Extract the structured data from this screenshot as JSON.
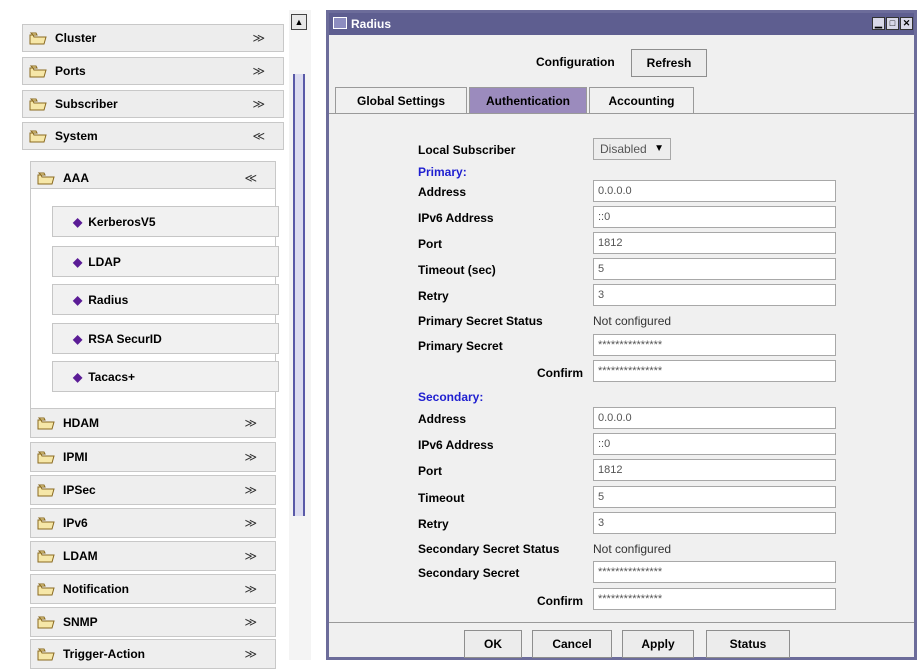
{
  "nav": {
    "top_items": [
      {
        "label": "Cluster",
        "chevron": "≫"
      },
      {
        "label": "Ports",
        "chevron": "≫"
      },
      {
        "label": "Subscriber",
        "chevron": "≫"
      },
      {
        "label": "System",
        "chevron": "≪"
      }
    ],
    "aaa": {
      "label": "AAA",
      "chevron": "≪"
    },
    "aaa_items": [
      "KerberosV5",
      "LDAP",
      "Radius",
      "RSA SecurID",
      "Tacacs+"
    ],
    "system_items": [
      {
        "label": "HDAM",
        "chevron": "≫"
      },
      {
        "label": "IPMI",
        "chevron": "≫"
      },
      {
        "label": "IPSec",
        "chevron": "≫"
      },
      {
        "label": "IPv6",
        "chevron": "≫"
      },
      {
        "label": "LDAM",
        "chevron": "≫"
      },
      {
        "label": "Notification",
        "chevron": "≫"
      },
      {
        "label": "SNMP",
        "chevron": "≫"
      },
      {
        "label": "Trigger-Action",
        "chevron": "≫"
      }
    ],
    "leaf_icon": "◆",
    "folder_icon": "folder-icon"
  },
  "window": {
    "title": "Radius",
    "configuration_label": "Configuration",
    "refresh_label": "Refresh",
    "tabs": [
      "Global Settings",
      "Authentication",
      "Accounting"
    ],
    "active_tab": "Authentication",
    "title_bar_color": "#5e5e90",
    "active_tab_color": "#9b8bbd"
  },
  "form": {
    "local_subscriber_label": "Local Subscriber",
    "local_subscriber_value": "Disabled",
    "primary": {
      "heading": "Primary:",
      "address_label": "Address",
      "address_value": "0.0.0.0",
      "ipv6_label": "IPv6 Address",
      "ipv6_value": "::0",
      "port_label": "Port",
      "port_value": "1812",
      "timeout_label": "Timeout (sec)",
      "timeout_value": "5",
      "retry_label": "Retry",
      "retry_value": "3",
      "secret_status_label": "Primary Secret Status",
      "secret_status_value": "Not configured",
      "secret_label": "Primary Secret",
      "secret_value": "***************",
      "confirm_label": "Confirm",
      "confirm_value": "***************"
    },
    "secondary": {
      "heading": "Secondary:",
      "address_label": "Address",
      "address_value": "0.0.0.0",
      "ipv6_label": "IPv6 Address",
      "ipv6_value": "::0",
      "port_label": "Port",
      "port_value": "1812",
      "timeout_label": "Timeout",
      "timeout_value": "5",
      "retry_label": "Retry",
      "retry_value": "3",
      "secret_status_label": "Secondary Secret Status",
      "secret_status_value": "Not configured",
      "secret_label": "Secondary Secret",
      "secret_value": "***************",
      "confirm_label": "Confirm",
      "confirm_value": "***************"
    }
  },
  "footer": {
    "ok_label": "OK",
    "cancel_label": "Cancel",
    "apply_label": "Apply",
    "status_label": "Status"
  }
}
